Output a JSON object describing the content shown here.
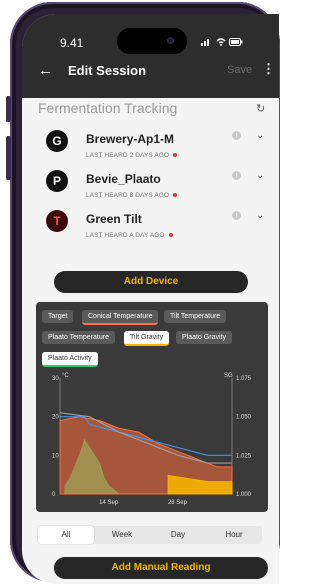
{
  "status": {
    "time": "9.41"
  },
  "appbar": {
    "title": "Edit Session",
    "save_label": "Save"
  },
  "section": {
    "title": "Fermentation Tracking"
  },
  "devices": [
    {
      "name": "Brewery-Ap1-M",
      "last_heard": "LAST HEARD 2 DAYS AGO",
      "logo": "G"
    },
    {
      "name": "Bevie_Plaato",
      "last_heard": "LAST HEARD 8 DAYS AGO",
      "logo": "P"
    },
    {
      "name": "Green Tilt",
      "last_heard": "LAST HEARD A DAY AGO",
      "logo": "T"
    }
  ],
  "add_device_label": "Add Device",
  "chart_chips": [
    {
      "label": "Target",
      "color": "#4a90e2"
    },
    {
      "label": "Conical Temperature",
      "color": "#ff6f3c"
    },
    {
      "label": "Tilt Temperature",
      "color": "#9e9e9e"
    },
    {
      "label": "Plaato Temperature",
      "color": "#b0b0b0"
    },
    {
      "label": "Tilt Gravity",
      "color": "#f5b400"
    },
    {
      "label": "Plaato Gravity",
      "color": "#8bc34a"
    },
    {
      "label": "Plaato Activity",
      "color": "#2ecc71"
    }
  ],
  "chart_data": {
    "type": "line",
    "ylabel": "°C",
    "y2label": "SG",
    "y_ticks": [
      0,
      10,
      20,
      30
    ],
    "y2_ticks": [
      "1.000",
      "1.025",
      "1.050",
      "1.075"
    ],
    "x_ticks": [
      "14 Sep",
      "28 Sep"
    ],
    "ylim": [
      0,
      30
    ],
    "y2lim": [
      1.0,
      1.075
    ],
    "series": [
      {
        "name": "Target",
        "color": "#4a90e2",
        "points": [
          [
            0,
            20
          ],
          [
            5,
            20
          ],
          [
            6,
            18
          ],
          [
            12,
            16
          ],
          [
            18,
            14
          ],
          [
            24,
            12
          ],
          [
            30,
            10
          ],
          [
            35,
            10
          ]
        ]
      },
      {
        "name": "Conical Temperature",
        "color": "#ff6f3c",
        "points": [
          [
            0,
            19
          ],
          [
            4,
            20
          ],
          [
            8,
            19
          ],
          [
            12,
            17
          ],
          [
            16,
            16
          ],
          [
            20,
            13
          ],
          [
            24,
            11
          ],
          [
            28,
            9
          ],
          [
            32,
            7
          ],
          [
            35,
            7
          ]
        ]
      },
      {
        "name": "Tilt Temperature",
        "color": "#9e9e9e",
        "points": [
          [
            0,
            21
          ],
          [
            6,
            20
          ],
          [
            12,
            16
          ],
          [
            18,
            13
          ],
          [
            24,
            10
          ],
          [
            30,
            8
          ],
          [
            35,
            8
          ]
        ]
      },
      {
        "name": "Tilt Gravity",
        "color": "#f5b400",
        "points": [
          [
            22,
            1.012
          ],
          [
            26,
            1.01
          ],
          [
            30,
            1.008
          ],
          [
            35,
            1.008
          ]
        ]
      },
      {
        "name": "Plaato Activity",
        "color": "#2ecc71",
        "points": [
          [
            1,
            2
          ],
          [
            2,
            4
          ],
          [
            3,
            7
          ],
          [
            4,
            10
          ],
          [
            5,
            14
          ],
          [
            6,
            12
          ],
          [
            7,
            10
          ],
          [
            8,
            8
          ],
          [
            9,
            4
          ],
          [
            10,
            2
          ],
          [
            11,
            1
          ],
          [
            12,
            0
          ]
        ]
      }
    ]
  },
  "range_tabs": [
    "All",
    "Week",
    "Day",
    "Hour"
  ],
  "add_manual_label": "Add Manual Reading"
}
